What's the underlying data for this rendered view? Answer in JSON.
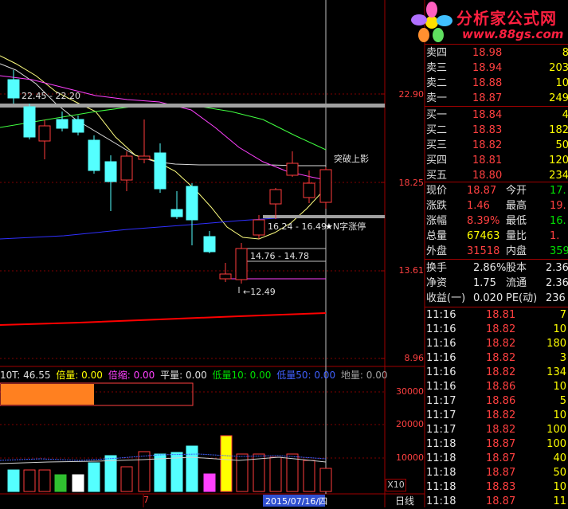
{
  "colors": {
    "background": "#000000",
    "grid_red": "#a00000",
    "up_candle": "#ff3c3c",
    "down_candle": "#54ffff",
    "ma_white": "#dcdcdc",
    "ma_yellow": "#ffff80",
    "ma_magenta": "#ff40ff",
    "ma_green": "#40ff40",
    "ma_blue": "#4040ff",
    "ma_red": "#ff0000"
  },
  "top_header_text": "突破上影",
  "logo": {
    "title": "分析家公式网",
    "url": "www.88gs.com"
  },
  "price_axis": {
    "ticks": [
      "22.90",
      "18.25",
      "13.61",
      "8.96"
    ]
  },
  "annotations": {
    "tupo": "突破上影",
    "nzi": "N字涨停",
    "range1": "22.45 - 22.20",
    "range2": "16.24 - 16.49",
    "range3": "14.76 - 14.78",
    "low": "12.49"
  },
  "volume_header": {
    "vol": "10T: 46.55",
    "beiliang": "倍量: 0.00",
    "beisuo": "倍缩: 0.00",
    "pingliang": "平量: 0.00",
    "diliang10": "低量10: 0.00",
    "diliang50": "低量50: 0.00",
    "diliang": "地量: 0.00"
  },
  "volume_axis": {
    "ticks": [
      "30000",
      "20000",
      "10000"
    ],
    "unit": "X10"
  },
  "bottom_bar": {
    "mark": "7",
    "date": "2015/07/16/四",
    "period": "日线"
  },
  "order_book": [
    {
      "label": "卖四",
      "price": "18.98",
      "vol": "8"
    },
    {
      "label": "卖三",
      "price": "18.94",
      "vol": "203"
    },
    {
      "label": "卖二",
      "price": "18.88",
      "vol": "10"
    },
    {
      "label": "卖一",
      "price": "18.87",
      "vol": "249"
    },
    {
      "label": "买一",
      "price": "18.84",
      "vol": "4"
    },
    {
      "label": "买二",
      "price": "18.83",
      "vol": "182"
    },
    {
      "label": "买三",
      "price": "18.82",
      "vol": "50"
    },
    {
      "label": "买四",
      "price": "18.81",
      "vol": "120"
    },
    {
      "label": "买五",
      "price": "18.80",
      "vol": "234"
    }
  ],
  "stats": [
    {
      "l1": "现价",
      "v1": "18.87",
      "l2": "今开",
      "v2": "17."
    },
    {
      "l1": "涨跌",
      "v1": "1.46",
      "l2": "最高",
      "v2": "19."
    },
    {
      "l1": "涨幅",
      "v1": "8.39%",
      "l2": "最低",
      "v2": "16."
    },
    {
      "l1": "总量",
      "v1": "67463",
      "l2": "量比",
      "v2": "1."
    },
    {
      "l1": "外盘",
      "v1": "31518",
      "l2": "内盘",
      "v2": "359"
    }
  ],
  "fundamentals": [
    {
      "l1": "换手",
      "v1": "2.86%",
      "l2": "股本",
      "v2": "2.36"
    },
    {
      "l1": "净资",
      "v1": "1.75",
      "l2": "流通",
      "v2": "2.36"
    },
    {
      "l1": "收益(一)",
      "v1": "0.020",
      "l2": "PE(动)",
      "v2": "236"
    }
  ],
  "ticks": [
    {
      "time": "11:16",
      "price": "18.81",
      "vol": "7"
    },
    {
      "time": "11:16",
      "price": "18.82",
      "vol": "10"
    },
    {
      "time": "11:16",
      "price": "18.82",
      "vol": "180"
    },
    {
      "time": "11:16",
      "price": "18.82",
      "vol": "3"
    },
    {
      "time": "11:16",
      "price": "18.82",
      "vol": "134"
    },
    {
      "time": "11:16",
      "price": "18.86",
      "vol": "10"
    },
    {
      "time": "11:17",
      "price": "18.86",
      "vol": "5"
    },
    {
      "time": "11:17",
      "price": "18.82",
      "vol": "10"
    },
    {
      "time": "11:17",
      "price": "18.82",
      "vol": "100"
    },
    {
      "time": "11:18",
      "price": "18.87",
      "vol": "100"
    },
    {
      "time": "11:18",
      "price": "18.87",
      "vol": "40"
    },
    {
      "time": "11:18",
      "price": "18.87",
      "vol": "50"
    },
    {
      "time": "11:18",
      "price": "18.83",
      "vol": "10"
    },
    {
      "time": "11:18",
      "price": "18.87",
      "vol": "11"
    }
  ]
}
